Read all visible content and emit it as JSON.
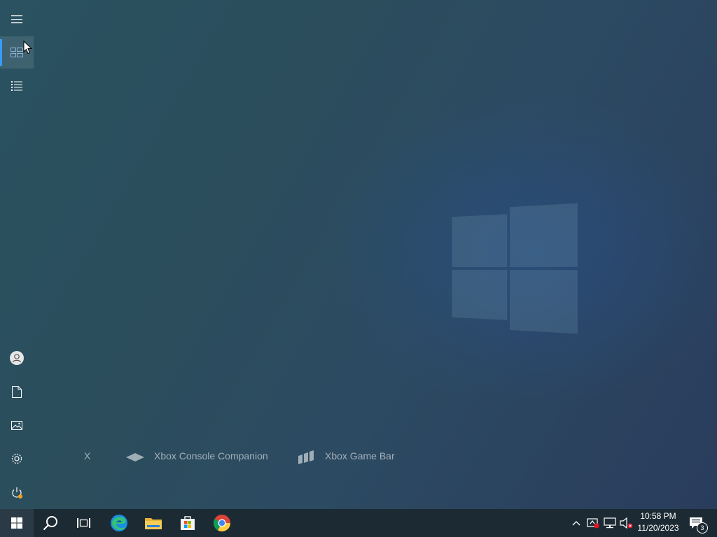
{
  "start_menu": {
    "rail": {
      "top_items": [
        {
          "name": "Expand",
          "icon": "hamburger-icon"
        },
        {
          "name": "Pinned tiles",
          "icon": "tiles-icon"
        },
        {
          "name": "All apps",
          "icon": "list-icon"
        }
      ],
      "bottom_items": [
        {
          "name": "User",
          "icon": "user-icon"
        },
        {
          "name": "Documents",
          "icon": "document-icon"
        },
        {
          "name": "Pictures",
          "icon": "pictures-icon"
        },
        {
          "name": "Settings",
          "icon": "gear-icon"
        },
        {
          "name": "Power",
          "icon": "power-icon"
        }
      ]
    },
    "apps_row": {
      "letter": "X",
      "app1": "Xbox Console Companion",
      "app2": "Xbox Game Bar"
    }
  },
  "taskbar": {
    "pinned": [
      {
        "name": "Start",
        "icon": "windows-logo-icon"
      },
      {
        "name": "Search",
        "icon": "search-icon"
      },
      {
        "name": "Task View",
        "icon": "task-view-icon"
      },
      {
        "name": "Microsoft Edge",
        "icon": "edge-icon"
      },
      {
        "name": "File Explorer",
        "icon": "folder-icon"
      },
      {
        "name": "Microsoft Store",
        "icon": "store-icon"
      },
      {
        "name": "Google Chrome",
        "icon": "chrome-icon"
      }
    ],
    "tray": {
      "time": "10:58 PM",
      "date": "11/20/2023",
      "notification_count": "3"
    }
  },
  "colors": {
    "accent": "#3a9bff",
    "taskbar": "#1c2a33"
  }
}
